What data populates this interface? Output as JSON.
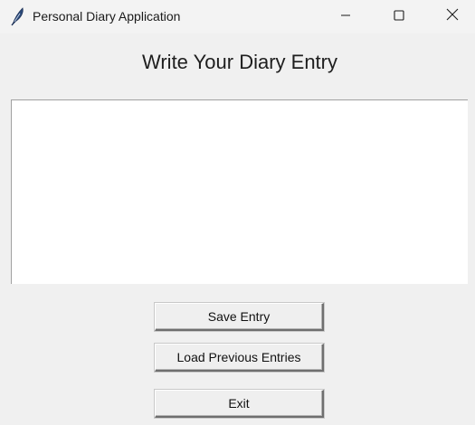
{
  "window": {
    "title": "Personal Diary Application",
    "app_icon": "feather-icon",
    "controls": {
      "minimize_icon": "minimize-icon",
      "maximize_icon": "maximize-icon",
      "close_icon": "close-icon"
    }
  },
  "main": {
    "heading": "Write Your Diary Entry",
    "entry_text": "",
    "buttons": {
      "save_label": "Save Entry",
      "load_label": "Load Previous Entries",
      "exit_label": "Exit"
    }
  },
  "colors": {
    "background": "#f0f0f0",
    "titlebar": "#f3f3f3",
    "entry_background": "#ffffff"
  }
}
